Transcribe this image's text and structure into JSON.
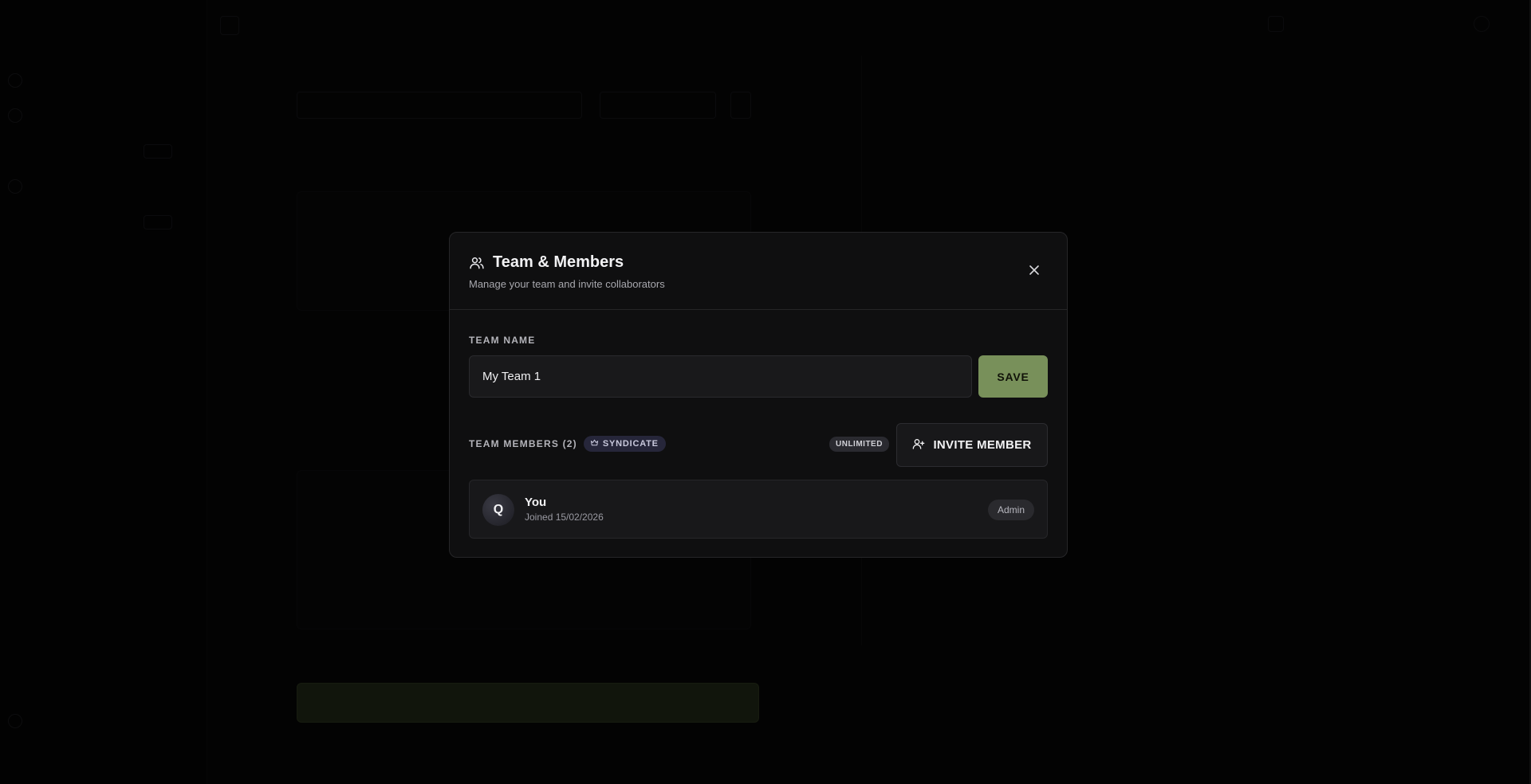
{
  "modal": {
    "title": "Team & Members",
    "subtitle": "Manage your team and invite collaborators",
    "team_name_label": "TEAM NAME",
    "team_name_value": "My Team 1",
    "save_label": "SAVE",
    "members_label": "TEAM MEMBERS (2)",
    "plan_badge": "SYNDICATE",
    "limit_badge": "UNLIMITED",
    "invite_label": "INVITE MEMBER",
    "members": [
      {
        "initial": "Q",
        "name": "You",
        "joined": "Joined 15/02/2026",
        "role": "Admin"
      }
    ]
  },
  "colors": {
    "accent": "#78905a",
    "modal_bg": "#0f0f10",
    "card_bg": "#18181a",
    "badge_bg": "#26263a"
  },
  "icons": [
    "users-icon",
    "close-icon",
    "crown-icon",
    "user-plus-icon"
  ]
}
